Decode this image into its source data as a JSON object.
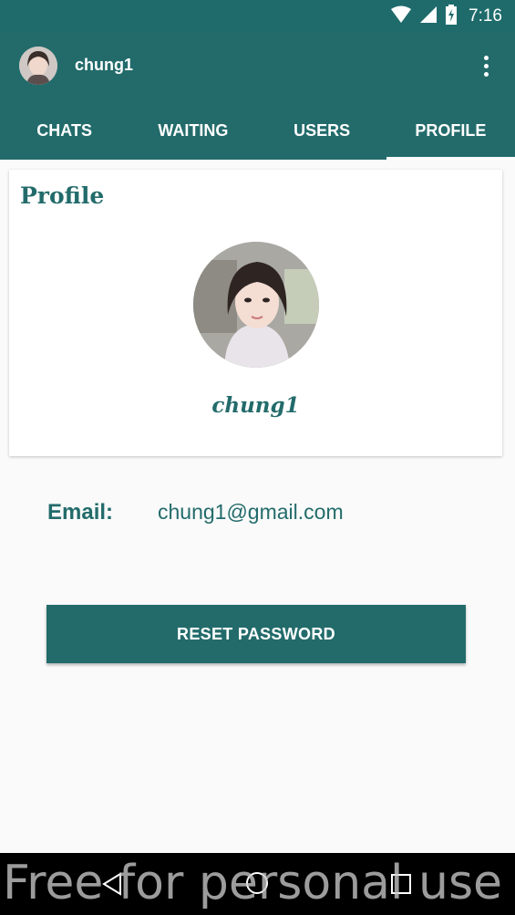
{
  "status_bar": {
    "time": "7:16",
    "icons": [
      "wifi-icon",
      "cellular-signal-icon",
      "battery-charging-icon"
    ]
  },
  "app_bar": {
    "title": "chung1",
    "avatar_icon": "user-avatar",
    "menu_icon": "more-vert-icon"
  },
  "tabs": [
    {
      "label": "CHATS",
      "active": false
    },
    {
      "label": "WAITING",
      "active": false
    },
    {
      "label": "USERS",
      "active": false
    },
    {
      "label": "PROFILE",
      "active": true
    }
  ],
  "profile": {
    "heading": "Profile",
    "name": "chung1",
    "photo_icon": "profile-photo"
  },
  "email": {
    "label": "Email:",
    "value": "chung1@gmail.com"
  },
  "reset_button": {
    "label": "RESET PASSWORD"
  },
  "nav_bar": {
    "icons": [
      "back-icon",
      "home-icon",
      "recents-icon"
    ]
  },
  "watermark": "Free for personal use",
  "colors": {
    "primary": "#236b6b",
    "background": "#fafafa",
    "card": "#ffffff"
  }
}
